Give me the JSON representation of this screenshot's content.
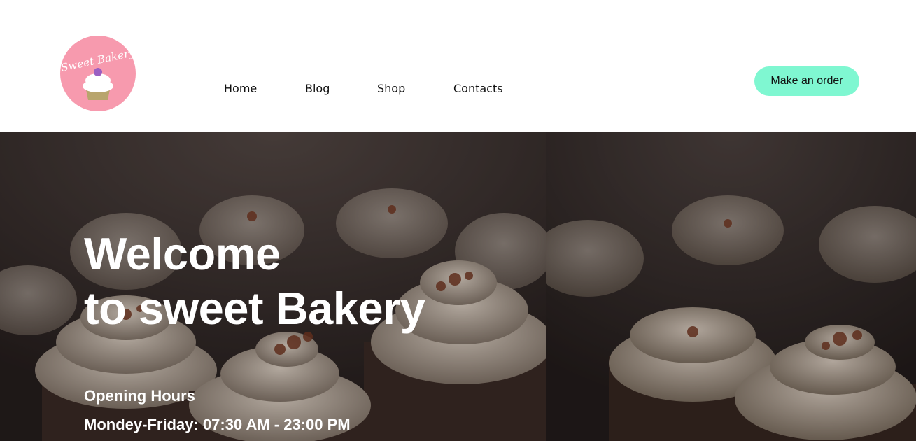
{
  "header": {
    "logo_text": "Sweet Bakery",
    "nav": [
      {
        "label": "Home"
      },
      {
        "label": "Blog"
      },
      {
        "label": "Shop"
      },
      {
        "label": "Contacts"
      }
    ],
    "order_button_label": "Make an order"
  },
  "hero": {
    "title_line1": "Welcome",
    "title_line2": "to sweet Bakery",
    "hours_title": "Opening Hours",
    "hours_line": "Mondey-Friday: 07:30 AM - 23:00 PM"
  },
  "colors": {
    "logo_bg": "#f79aae",
    "order_button_bg": "#7ff7d1",
    "hero_bg": "#2b2523",
    "frosting": "#e9dccb",
    "cake": "#3a2a24",
    "crumbs": "#7a3a22"
  }
}
